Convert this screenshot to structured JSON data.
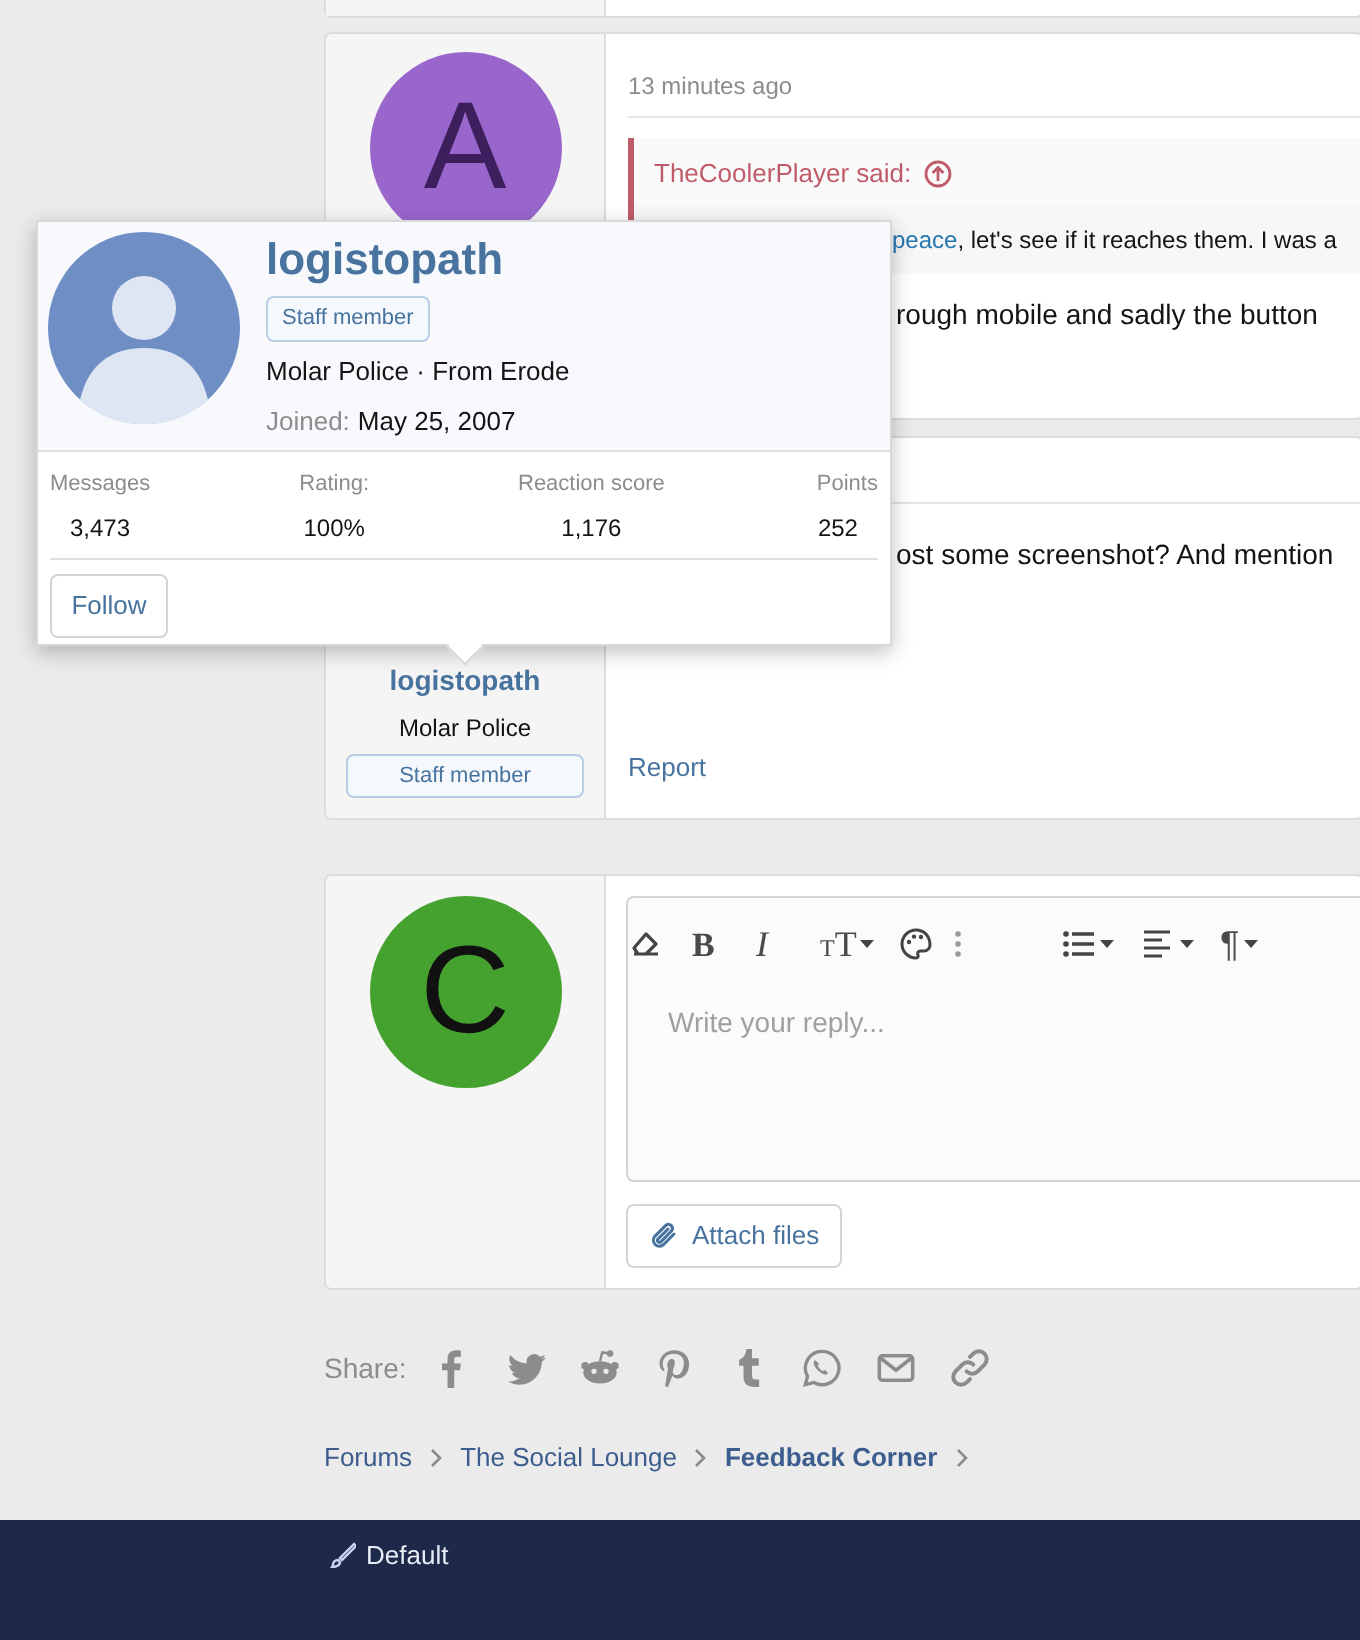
{
  "posts": [
    {
      "avatar": {
        "letter": "A",
        "color": "#9966cc"
      },
      "time": "13 minutes ago",
      "quote": {
        "author": "TheCoolerPlayer said:",
        "link": "peace",
        "text": ", let's see if it reaches them. I was a"
      },
      "message": "rough mobile and sadly the button"
    },
    {
      "user": {
        "name": "logistopath",
        "title": "Molar Police",
        "badge": "Staff member"
      },
      "message": "ost some screenshot? And mention",
      "actions": [
        "Report"
      ]
    }
  ],
  "member_tooltip": {
    "name": "logistopath",
    "badge": "Staff member",
    "title_line": "Molar Police · From Erode",
    "joined_label": "Joined:",
    "joined": "May 25, 2007",
    "stats": [
      {
        "label": "Messages",
        "value": "3,473"
      },
      {
        "label": "Rating:",
        "value": "100%"
      },
      {
        "label": "Reaction score",
        "value": "1,176"
      },
      {
        "label": "Points",
        "value": "252"
      }
    ],
    "follow_button": "Follow"
  },
  "reply": {
    "avatar": {
      "letter": "C",
      "color": "#46a22e"
    },
    "toolbar": [
      {
        "kind": "eraser",
        "caret": false
      },
      {
        "kind": "bold",
        "label": "B",
        "caret": false
      },
      {
        "kind": "italic",
        "label": "I",
        "caret": false
      },
      {
        "kind": "size",
        "label": "TT",
        "caret": true
      },
      {
        "kind": "palette",
        "caret": false
      },
      {
        "kind": "more",
        "caret": false
      },
      {
        "kind": "list",
        "caret": true
      },
      {
        "kind": "align",
        "caret": true
      },
      {
        "kind": "paragraph",
        "label": "¶",
        "caret": true
      }
    ],
    "placeholder": "Write your reply...",
    "attach_button": "Attach files"
  },
  "share_label": "Share:",
  "breadcrumbs": [
    {
      "label": "Forums",
      "current": false
    },
    {
      "label": "The Social Lounge",
      "current": false
    },
    {
      "label": "Feedback Corner",
      "current": true
    }
  ],
  "footer": {
    "style_chooser": "Default"
  }
}
